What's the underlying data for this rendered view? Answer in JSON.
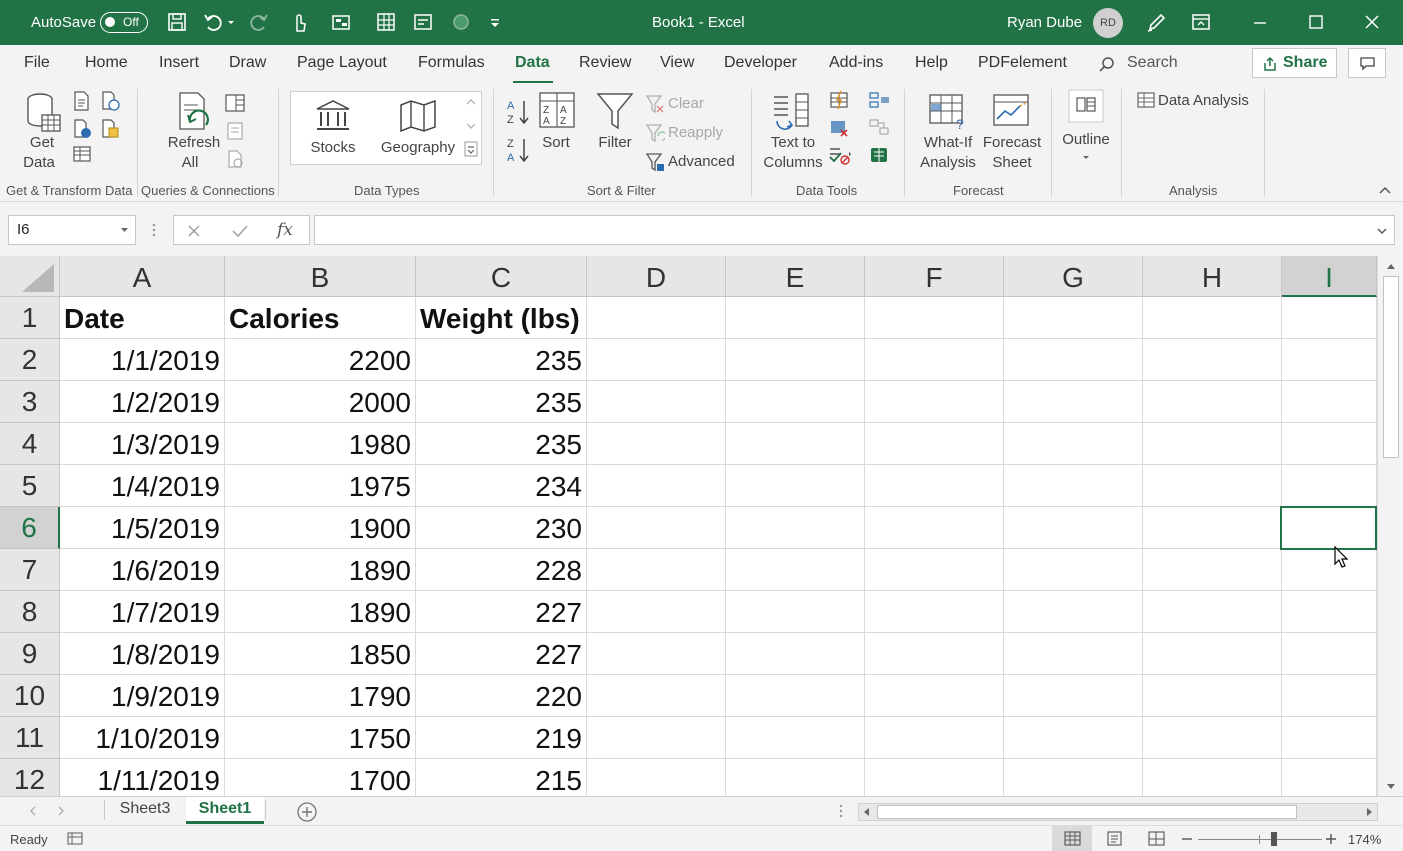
{
  "titlebar": {
    "autosave_label": "AutoSave",
    "autosave_state": "Off",
    "doc_title": "Book1  -  Excel",
    "user_name": "Ryan Dube",
    "user_initials": "RD"
  },
  "ribbon_tabs": {
    "file": "File",
    "home": "Home",
    "insert": "Insert",
    "draw": "Draw",
    "page_layout": "Page Layout",
    "formulas": "Formulas",
    "data": "Data",
    "review": "Review",
    "view": "View",
    "developer": "Developer",
    "addins": "Add-ins",
    "help": "Help",
    "pdfelement": "PDFelement",
    "search": "Search",
    "share": "Share"
  },
  "ribbon": {
    "get_data_1": "Get",
    "get_data_2": "Data",
    "refresh_1": "Refresh",
    "refresh_2": "All",
    "stocks": "Stocks",
    "geography": "Geography",
    "sort": "Sort",
    "filter": "Filter",
    "clear": "Clear",
    "reapply": "Reapply",
    "advanced": "Advanced",
    "text_to_columns_1": "Text to",
    "text_to_columns_2": "Columns",
    "whatif_1": "What-If",
    "whatif_2": "Analysis",
    "forecast_1": "Forecast",
    "forecast_2": "Sheet",
    "outline": "Outline",
    "data_analysis": "Data Analysis",
    "groups": {
      "get_transform": "Get & Transform Data",
      "queries": "Queries & Connections",
      "data_types": "Data Types",
      "sort_filter": "Sort & Filter",
      "data_tools": "Data Tools",
      "forecast": "Forecast",
      "analysis": "Analysis"
    }
  },
  "formula_bar": {
    "name_box": "I6",
    "fx": "fx",
    "content": ""
  },
  "sheet": {
    "columns": [
      "A",
      "B",
      "C",
      "D",
      "E",
      "F",
      "G",
      "H",
      "I"
    ],
    "rows": [
      [
        "1",
        "Date",
        "Calories",
        "Weight (lbs)"
      ],
      [
        "2",
        "1/1/2019",
        "2200",
        "235"
      ],
      [
        "3",
        "1/2/2019",
        "2000",
        "235"
      ],
      [
        "4",
        "1/3/2019",
        "1980",
        "235"
      ],
      [
        "5",
        "1/4/2019",
        "1975",
        "234"
      ],
      [
        "6",
        "1/5/2019",
        "1900",
        "230"
      ],
      [
        "7",
        "1/6/2019",
        "1890",
        "228"
      ],
      [
        "8",
        "1/7/2019",
        "1890",
        "227"
      ],
      [
        "9",
        "1/8/2019",
        "1850",
        "227"
      ],
      [
        "10",
        "1/9/2019",
        "1790",
        "220"
      ],
      [
        "11",
        "1/10/2019",
        "1750",
        "219"
      ],
      [
        "12",
        "1/11/2019",
        "1700",
        "215"
      ]
    ]
  },
  "sheet_tabs": [
    "Sheet3",
    "Sheet1"
  ],
  "statusbar": {
    "status": "Ready",
    "zoom": "174%"
  },
  "colors": {
    "accent": "#217346",
    "ribbon_bg": "#f3f3f3",
    "header_bg": "#e6e6e6"
  }
}
